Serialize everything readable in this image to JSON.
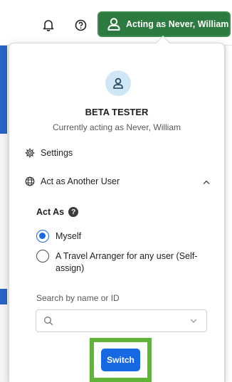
{
  "header": {
    "notifications_icon": "bell-icon",
    "help_icon": "question-circle-icon",
    "acting_button_label": "Acting as Never, William",
    "acting_button_icon": "user-icon",
    "accent_color": "#2c7a3f"
  },
  "panel": {
    "avatar_icon": "user-icon",
    "title": "BETA TESTER",
    "subtitle": "Currently acting as Never, William",
    "settings_label": "Settings",
    "settings_icon": "gear-icon",
    "act_as_another_label": "Act as Another User",
    "act_as_another_icon": "globe-icon",
    "act_as_section": {
      "label": "Act As",
      "help_icon": "question-circle-icon",
      "options": [
        {
          "label": "Myself",
          "selected": true
        },
        {
          "label": "A Travel Arranger for any user (Self-assign)",
          "selected": false
        }
      ]
    },
    "search": {
      "label": "Search by name or ID",
      "value": "",
      "placeholder": ""
    },
    "switch_button_label": "Switch",
    "primary_color": "#1668e3",
    "highlight_color": "#5fb33a"
  }
}
